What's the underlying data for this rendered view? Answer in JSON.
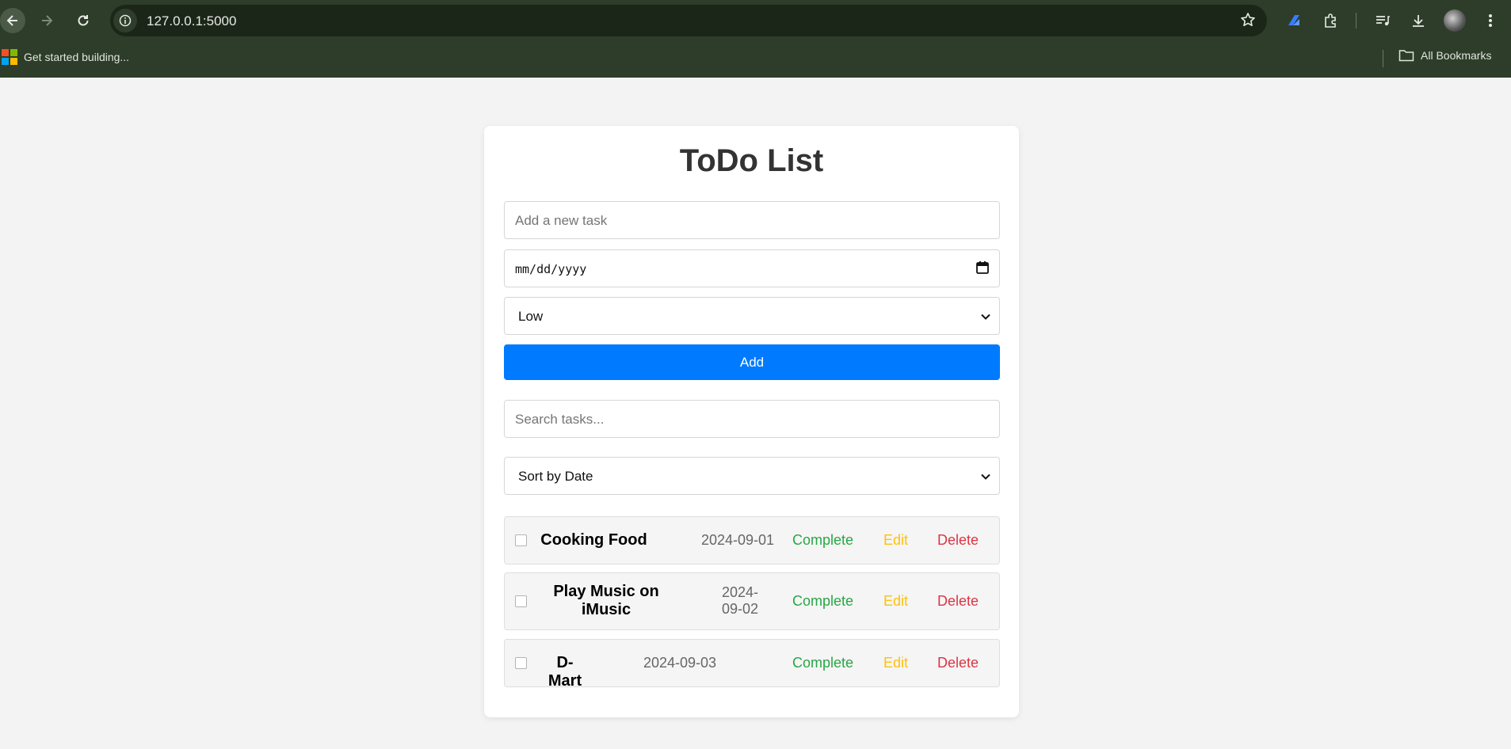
{
  "browser": {
    "url": "127.0.0.1:5000",
    "bookmarks": {
      "first": "Get started building...",
      "all": "All Bookmarks"
    }
  },
  "app": {
    "title": "ToDo List",
    "task_input": {
      "placeholder": "Add a new task",
      "value": ""
    },
    "date_input": {
      "value": "mm/dd/yyyy"
    },
    "priority_select": {
      "selected": "Low"
    },
    "add_label": "Add",
    "search_input": {
      "placeholder": "Search tasks...",
      "value": ""
    },
    "sort_select": {
      "selected": "Sort by Date"
    },
    "tasks": [
      {
        "name": "Cooking Food",
        "date": "2024-09-01",
        "complete": "Complete",
        "edit": "Edit",
        "delete": "Delete",
        "checked": false
      },
      {
        "name": "Play Music on iMusic",
        "date": "2024-09-02",
        "complete": "Complete",
        "edit": "Edit",
        "delete": "Delete",
        "checked": false
      },
      {
        "name": "D-Mart",
        "date": "2024-09-03",
        "complete": "Complete",
        "edit": "Edit",
        "delete": "Delete",
        "checked": false
      }
    ]
  },
  "colors": {
    "chrome": "#2d3d29",
    "primary": "#007bff",
    "complete": "#28a745",
    "edit": "#ffc107",
    "delete": "#dc3545"
  }
}
